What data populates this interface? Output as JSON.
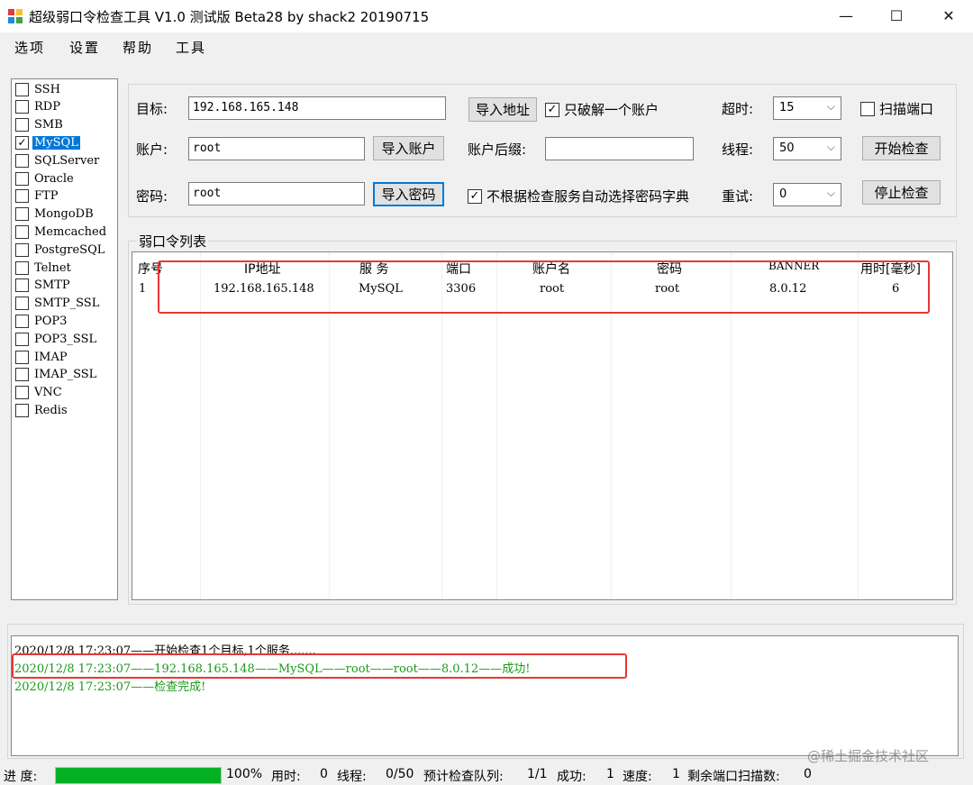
{
  "window": {
    "title": "超级弱口令检查工具 V1.0 测试版 Beta28 by shack2 20190715",
    "minimize_glyph": "—",
    "maximize_glyph": "☐",
    "close_glyph": "✕"
  },
  "menu": [
    "选项",
    "设置",
    "帮助",
    "工具"
  ],
  "services": [
    {
      "name": "SSH",
      "checked": false
    },
    {
      "name": "RDP",
      "checked": false
    },
    {
      "name": "SMB",
      "checked": false
    },
    {
      "name": "MySQL",
      "checked": true
    },
    {
      "name": "SQLServer",
      "checked": false
    },
    {
      "name": "Oracle",
      "checked": false
    },
    {
      "name": "FTP",
      "checked": false
    },
    {
      "name": "MongoDB",
      "checked": false
    },
    {
      "name": "Memcached",
      "checked": false
    },
    {
      "name": "PostgreSQL",
      "checked": false
    },
    {
      "name": "Telnet",
      "checked": false
    },
    {
      "name": "SMTP",
      "checked": false
    },
    {
      "name": "SMTP_SSL",
      "checked": false
    },
    {
      "name": "POP3",
      "checked": false
    },
    {
      "name": "POP3_SSL",
      "checked": false
    },
    {
      "name": "IMAP",
      "checked": false
    },
    {
      "name": "IMAP_SSL",
      "checked": false
    },
    {
      "name": "VNC",
      "checked": false
    },
    {
      "name": "Redis",
      "checked": false
    }
  ],
  "config": {
    "target_label": "目标:",
    "target_value": "192.168.165.148",
    "import_address": "导入地址",
    "crack_one_account": "只破解一个账户",
    "timeout_label": "超时:",
    "timeout_value": "15",
    "scan_port": "扫描端口",
    "account_label": "账户:",
    "account_value": "root",
    "import_account": "导入账户",
    "account_suffix_label": "账户后缀:",
    "account_suffix_value": "",
    "threads_label": "线程:",
    "threads_value": "50",
    "start_check": "开始检查",
    "password_label": "密码:",
    "password_value": "root",
    "import_password": "导入密码",
    "auto_dict": "不根据检查服务自动选择密码字典",
    "retry_label": "重试:",
    "retry_value": "0",
    "stop_check": "停止检查",
    "dropdown_arrow": "⌵",
    "check_glyph": "✓"
  },
  "results": {
    "caption": "弱口令列表",
    "columns": [
      "序号",
      "IP地址",
      "服 务",
      "端口",
      "账户名",
      "密码",
      "BANNER",
      "用时[毫秒]"
    ],
    "rows": [
      [
        "1",
        "192.168.165.148",
        "MySQL",
        "3306",
        "root",
        "root",
        "8.0.12",
        "6"
      ]
    ]
  },
  "log": [
    {
      "text": "2020/12/8 17:23:07——开始检查1个目标,1个服务.......",
      "color": "#000000"
    },
    {
      "text": "2020/12/8 17:23:07——192.168.165.148——MySQL——root——root——8.0.12——成功!",
      "color": "#1a9a1a"
    },
    {
      "text": "2020/12/8 17:23:07——检查完成!",
      "color": "#1a9a1a"
    }
  ],
  "status": {
    "progress_label": "进 度:",
    "progress_percent": 100,
    "progress_text": "100%",
    "elapsed_label": "用时:",
    "elapsed_value": "0",
    "threads_label": "线程:",
    "threads_value": "0/50",
    "queue_label": "预计检查队列:",
    "queue_value": "1/1",
    "success_label": "成功:",
    "success_value": "1",
    "speed_label": "速度:",
    "speed_value": "1",
    "remaining_label": "剩余端口扫描数:",
    "remaining_value": "0"
  },
  "watermark": "@稀土掘金技术社区",
  "colors": {
    "accent": "#0078d7",
    "highlight_box": "#e53935",
    "success": "#1a9a1a",
    "progress": "#06b025"
  }
}
